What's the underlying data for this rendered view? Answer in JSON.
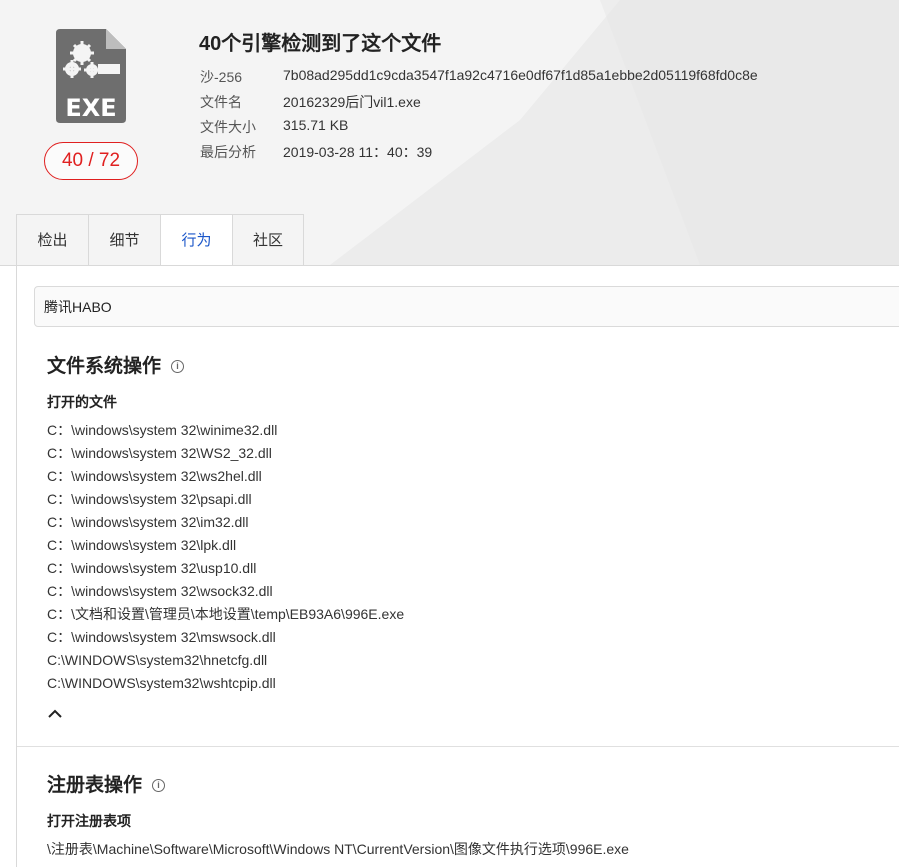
{
  "header": {
    "title": "40个引擎检测到了这个文件",
    "score": "40 / 72",
    "file_icon_label": "EXE",
    "meta": [
      {
        "key": "沙-256",
        "value": "7b08ad295dd1c9cda3547f1a92c4716e0df67f1d85a1ebbe2d05119f68fd0c8e"
      },
      {
        "key": "文件名",
        "value": "20162329后门vil1.exe"
      },
      {
        "key": "文件大小",
        "value": "315.71 KB"
      },
      {
        "key": "最后分析",
        "value": "2019-03-28 11：40：39"
      }
    ]
  },
  "tabs": [
    {
      "label": "检出",
      "active": false
    },
    {
      "label": "细节",
      "active": false
    },
    {
      "label": "行为",
      "active": true
    },
    {
      "label": "社区",
      "active": false
    }
  ],
  "sandbox": {
    "selected": "腾讯HABO"
  },
  "filesystem": {
    "title": "文件系统操作",
    "info_icon": "i",
    "opened_files_title": "打开的文件",
    "opened_files": [
      "C：\\windows\\system 32\\winime32.dll",
      "C：\\windows\\system 32\\WS2_32.dll",
      "C：\\windows\\system 32\\ws2hel.dll",
      "C：\\windows\\system 32\\psapi.dll",
      "C：\\windows\\system 32\\im32.dll",
      "C：\\windows\\system 32\\lpk.dll",
      "C：\\windows\\system 32\\usp10.dll",
      "C：\\windows\\system 32\\wsock32.dll",
      "C：\\文档和设置\\管理员\\本地设置\\temp\\EB93A6\\996E.exe",
      "C：\\windows\\system 32\\mswsock.dll",
      "C:\\WINDOWS\\system32\\hnetcfg.dll",
      "C:\\WINDOWS\\system32\\wshtcpip.dll"
    ]
  },
  "registry": {
    "title": "注册表操作",
    "info_icon": "i",
    "opened_keys_title": "打开注册表项",
    "opened_keys": [
      "\\注册表\\Machine\\Software\\Microsoft\\Windows NT\\CurrentVersion\\图像文件执行选项\\996E.exe"
    ]
  },
  "colors": {
    "accent": "#1a56c9",
    "danger": "#e02020",
    "header_bg": "#f4f4f4"
  }
}
